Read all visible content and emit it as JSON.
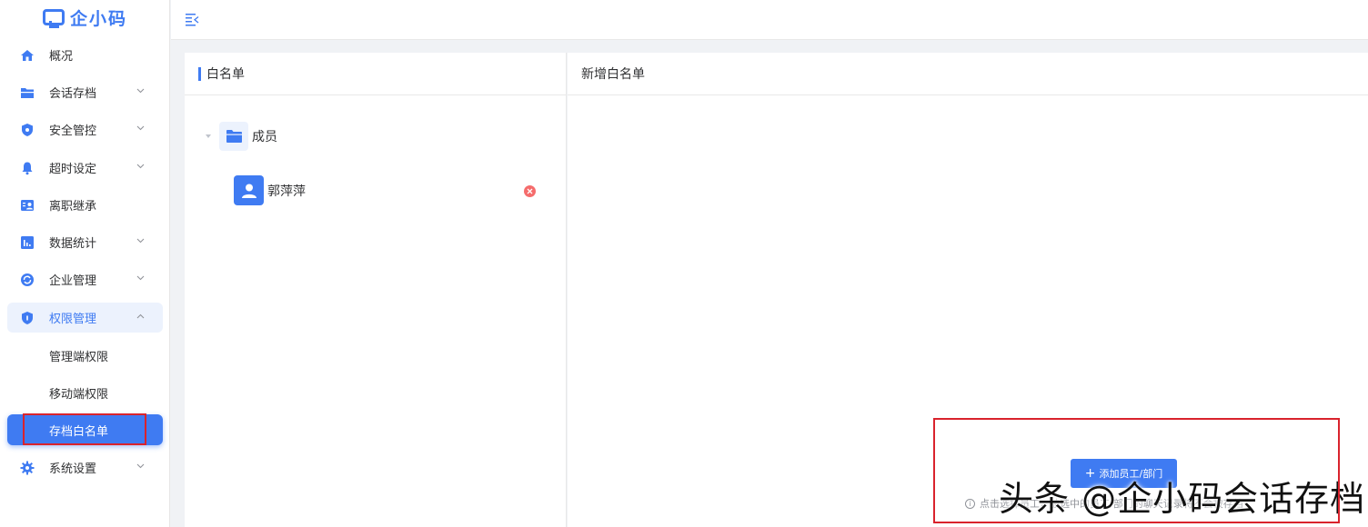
{
  "app": {
    "logo_text": "企小码"
  },
  "colors": {
    "accent": "#3f7bf2",
    "danger": "#f56c6c",
    "highlight_frame": "#d9232d"
  },
  "sidebar": {
    "items": [
      {
        "label": "概况",
        "icon": "home-icon",
        "has_arrow": false
      },
      {
        "label": "会话存档",
        "icon": "folder-icon",
        "has_arrow": true
      },
      {
        "label": "安全管控",
        "icon": "shield-icon",
        "has_arrow": true
      },
      {
        "label": "超时设定",
        "icon": "bell-icon",
        "has_arrow": true
      },
      {
        "label": "离职继承",
        "icon": "user-card-icon",
        "has_arrow": false
      },
      {
        "label": "数据统计",
        "icon": "bar-chart-icon",
        "has_arrow": true
      },
      {
        "label": "企业管理",
        "icon": "sync-icon",
        "has_arrow": true
      },
      {
        "label": "权限管理",
        "icon": "lock-shield-icon",
        "has_arrow": true,
        "expanded": true
      }
    ],
    "sub_items": [
      {
        "label": "管理端权限"
      },
      {
        "label": "移动端权限"
      },
      {
        "label": "存档白名单",
        "active": true
      }
    ],
    "footer_item": {
      "label": "系统设置",
      "icon": "gear-icon",
      "has_arrow": true
    }
  },
  "topbar": {
    "collapse_icon": "menu-fold-icon"
  },
  "whitelist_panel": {
    "title": "白名单",
    "tree": {
      "group_label": "成员",
      "members": [
        {
          "name": "郭萍萍"
        }
      ]
    }
  },
  "add_panel": {
    "title": "新增白名单",
    "add_button_label": "添加员工/部门",
    "hint_text": "点击选择员工，被选中的员工/部门的聊天记录将不会被存档"
  },
  "watermark": "头条 @企小码会话存档"
}
